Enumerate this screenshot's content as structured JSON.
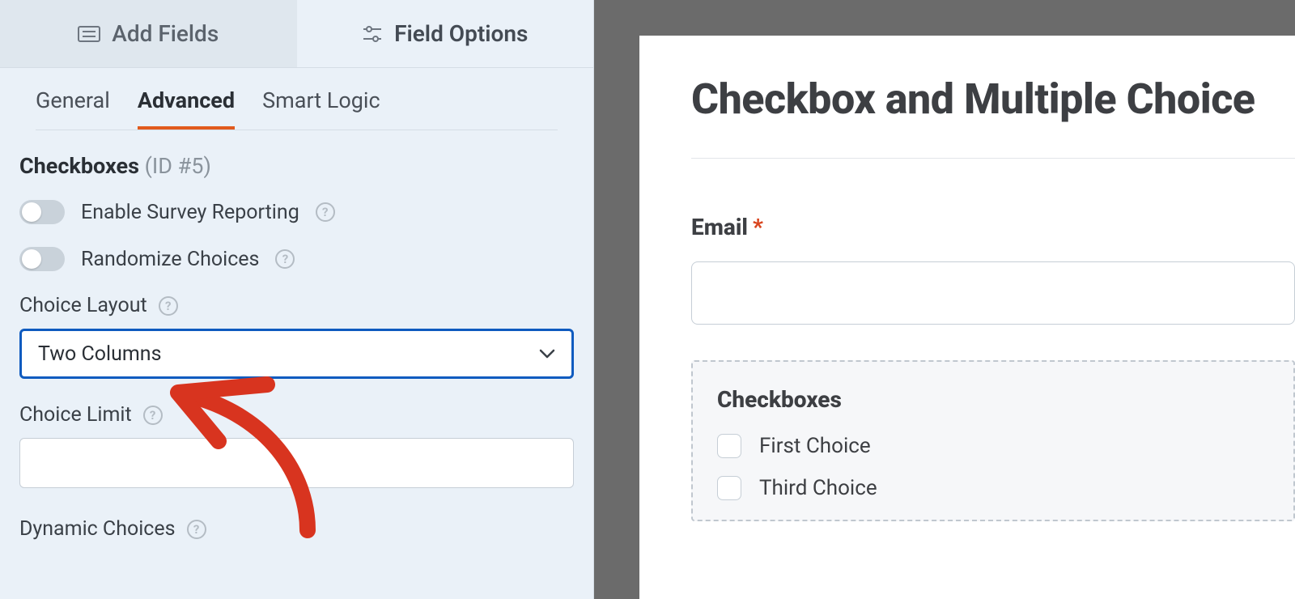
{
  "top_tabs": {
    "add_fields": "Add Fields",
    "field_options": "Field Options"
  },
  "sub_tabs": {
    "general": "General",
    "advanced": "Advanced",
    "smart_logic": "Smart Logic"
  },
  "field_header": {
    "name": "Checkboxes",
    "id": "(ID #5)"
  },
  "toggles": {
    "survey_reporting": "Enable Survey Reporting",
    "randomize": "Randomize Choices"
  },
  "choice_layout": {
    "label": "Choice Layout",
    "value": "Two Columns"
  },
  "choice_limit": {
    "label": "Choice Limit",
    "value": ""
  },
  "dynamic_choices": {
    "label": "Dynamic Choices"
  },
  "preview": {
    "form_title": "Checkbox and Multiple Choice",
    "email_label": "Email",
    "required_mark": "*",
    "checkboxes_title": "Checkboxes",
    "choices": [
      "First Choice",
      "Third Choice"
    ]
  },
  "help_glyph": "?"
}
